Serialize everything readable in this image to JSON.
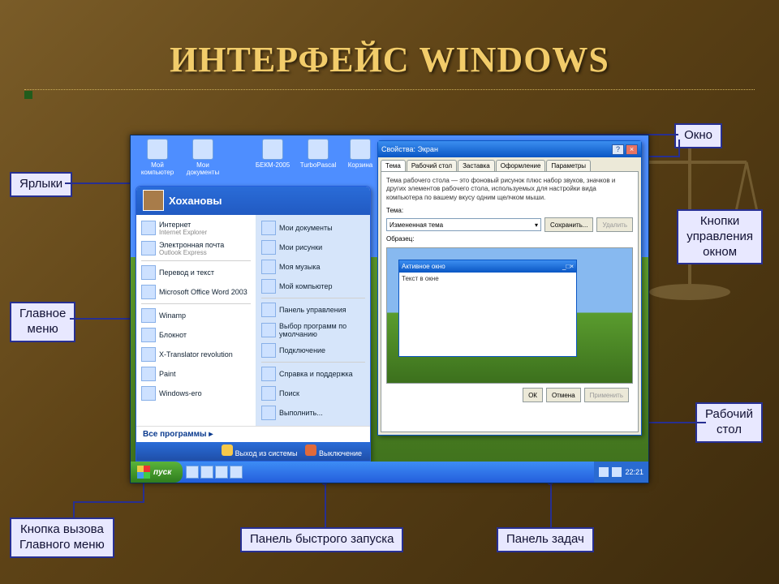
{
  "slide": {
    "title": "ИНТЕРФЕЙС WINDOWS"
  },
  "callouts": {
    "shortcuts": "Ярлыки",
    "mainmenu": "Главное\nменю",
    "startbutton": "Кнопка вызова\nГлавного меню",
    "quicklaunch": "Панель быстрого запуска",
    "taskbar": "Панель задач",
    "desktop": "Рабочий\nстол",
    "windowcontrols": "Кнопки\nуправления\nокном",
    "window": "Окно"
  },
  "desktop": {
    "icons": [
      "Мой компьютер",
      "Мои документы",
      "БЕКМ-2005",
      "TurboPascal",
      "Корзина"
    ]
  },
  "startmenu": {
    "user": "Хохановы",
    "left": [
      {
        "label": "Интернет",
        "sub": "Internet Explorer"
      },
      {
        "label": "Электронная почта",
        "sub": "Outlook Express"
      },
      {
        "label": "Перевод и текст",
        "sub": ""
      },
      {
        "label": "Microsoft Office Word 2003",
        "sub": ""
      },
      {
        "label": "Winamp",
        "sub": ""
      },
      {
        "label": "Блокнот",
        "sub": ""
      },
      {
        "label": "X-Translator revolution",
        "sub": ""
      },
      {
        "label": "Paint",
        "sub": ""
      },
      {
        "label": "Windows-его",
        "sub": ""
      }
    ],
    "right": [
      "Мои документы",
      "Мои рисунки",
      "Моя музыка",
      "Мой компьютер",
      "Панель управления",
      "Выбор программ по умолчанию",
      "Подключение",
      "Справка и поддержка",
      "Поиск",
      "Выполнить..."
    ],
    "allprograms": "Все программы",
    "footer": {
      "logoff": "Выход из системы",
      "shutdown": "Выключение"
    }
  },
  "propwindow": {
    "title": "Свойства: Экран",
    "tabs": [
      "Тема",
      "Рабочий стол",
      "Заставка",
      "Оформление",
      "Параметры"
    ],
    "activeTab": 0,
    "desc": "Тема рабочего стола — это фоновый рисунок плюс набор звуков, значков и других элементов рабочего стола, используемых для настройки вида компьютера по вашему вкусу одним щелчком мыши.",
    "themeLabel": "Тема:",
    "themeValue": "Измененная тема",
    "saveBtn": "Сохранить...",
    "deleteBtn": "Удалить",
    "previewLabel": "Образец:",
    "innerTitle": "Активное окно",
    "innerText": "Текст в окне",
    "ok": "ОК",
    "cancel": "Отмена",
    "apply": "Применить"
  },
  "taskbar": {
    "start": "пуск",
    "time": "22:21"
  }
}
